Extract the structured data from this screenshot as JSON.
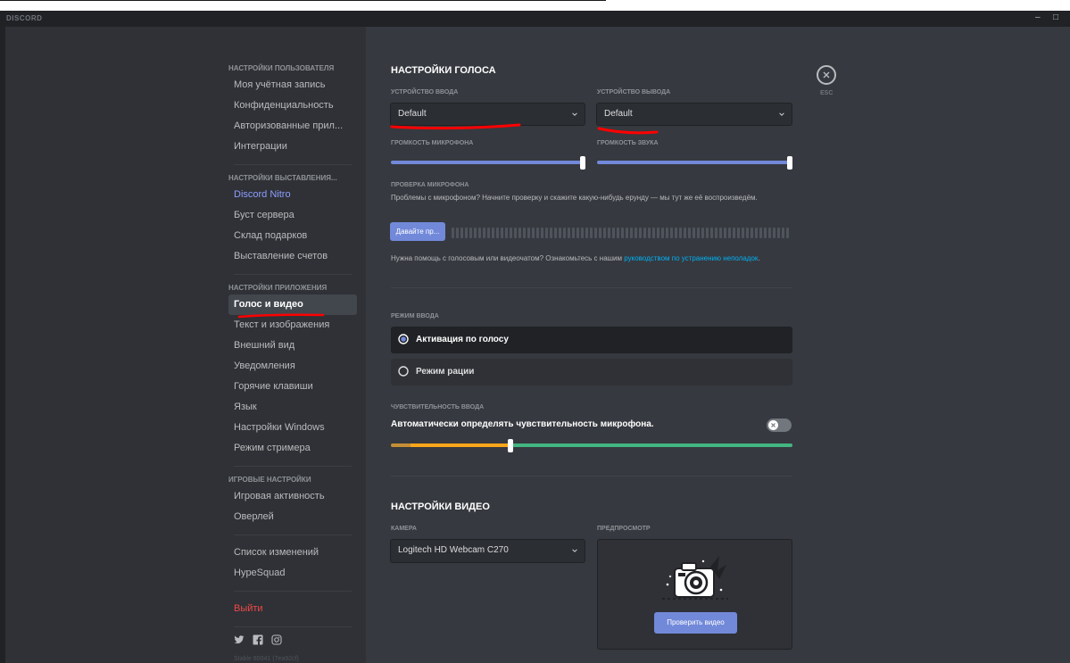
{
  "app": {
    "logo": "DISCORD",
    "minimize": "–",
    "maximize": "□"
  },
  "sidebar": {
    "sections": [
      {
        "header": "НАСТРОЙКИ ПОЛЬЗОВАТЕЛЯ",
        "items": [
          "Моя учётная запись",
          "Конфиденциальность",
          "Авторизованные прил...",
          "Интеграции"
        ]
      },
      {
        "header": "НАСТРОЙКИ ВЫСТАВЛЕНИЯ...",
        "items": [
          "Discord Nitro",
          "Буст сервера",
          "Склад подарков",
          "Выставление счетов"
        ]
      },
      {
        "header": "НАСТРОЙКИ ПРИЛОЖЕНИЯ",
        "items": [
          "Голос и видео",
          "Текст и изображения",
          "Внешний вид",
          "Уведомления",
          "Горячие клавиши",
          "Язык",
          "Настройки Windows",
          "Режим стримера"
        ]
      },
      {
        "header": "ИГРОВЫЕ НАСТРОЙКИ",
        "items": [
          "Игровая активность",
          "Оверлей"
        ]
      }
    ],
    "extra": [
      "Список изменений",
      "HypeSquad"
    ],
    "logout": "Выйти",
    "socials": [
      "twitter-icon",
      "facebook-icon",
      "instagram-icon"
    ],
    "build": "Stable 80041 (7ea92cf)"
  },
  "voice": {
    "title": "НАСТРОЙКИ ГОЛОСА",
    "input_label": "УСТРОЙСТВО ВВОДА",
    "input_value": "Default",
    "output_label": "УСТРОЙСТВО ВЫВОДА",
    "output_value": "Default",
    "mic_volume_label": "ГРОМКОСТЬ МИКРОФОНА",
    "mic_volume": 1.0,
    "sound_volume_label": "ГРОМКОСТЬ ЗВУКА",
    "sound_volume": 1.0,
    "mic_test_label": "ПРОВЕРКА МИКРОФОНА",
    "mic_test_desc": "Проблемы с микрофоном? Начните проверку и скажите какую-нибудь ерунду — мы тут же её воспроизведём.",
    "mic_test_button": "Давайте пр...",
    "help_text": "Нужна помощь с голосовым или видеочатом? Ознакомьтесь с нашим ",
    "help_link": "руководством по устранению неполадок",
    "help_end": ".",
    "mode_label": "РЕЖИМ ВВОДА",
    "mode_voice": "Активация по голосу",
    "mode_ptt": "Режим рации",
    "sensitivity_label": "ЧУВСТВИТЕЛЬНОСТЬ ВВОДА",
    "sensitivity_auto": "Автоматически определять чувствительность микрофона.",
    "sensitivity_level": 0.3
  },
  "video": {
    "title": "НАСТРОЙКИ ВИДЕО",
    "camera_label": "КАМЕРА",
    "camera_value": "Logitech HD Webcam C270",
    "preview_label": "ПРЕДПРОСМОТР",
    "test_button": "Проверить видео"
  },
  "esc": "ESC",
  "colors": {
    "accent": "#7289da",
    "danger": "#f04747",
    "link": "#00b0f4",
    "annotation": "#ff0000"
  }
}
